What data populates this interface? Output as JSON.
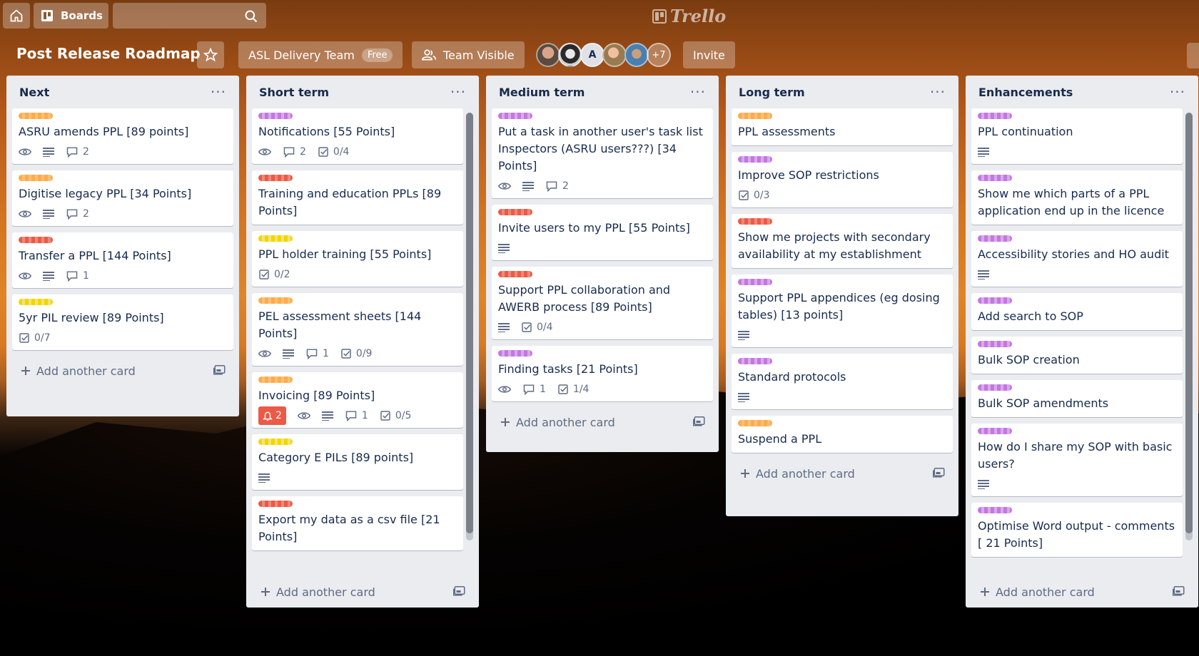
{
  "header": {
    "boards_label": "Boards",
    "search_placeholder": "",
    "logo_text": "Trello"
  },
  "board": {
    "title": "Post Release Roadmap",
    "team_name": "ASL Delivery Team",
    "team_plan": "Free",
    "visibility": "Team Visible",
    "members_extra": "+7",
    "member_initial": "A",
    "invite_label": "Invite"
  },
  "lists": [
    {
      "title": "Next",
      "add_label": "Add another card",
      "cards": [
        {
          "label": "orange",
          "title": "ASRU amends PPL [89 points]",
          "watch": true,
          "desc": true,
          "comments": "2"
        },
        {
          "label": "orange",
          "title": "Digitise legacy PPL [34 Points]",
          "watch": true,
          "desc": true,
          "comments": "2"
        },
        {
          "label": "red",
          "title": "Transfer a PPL [144 Points]",
          "watch": true,
          "desc": true,
          "comments": "1"
        },
        {
          "label": "yellow",
          "title": "5yr PIL review [89 Points]",
          "checklist": "0/7"
        }
      ]
    },
    {
      "title": "Short term",
      "add_label": "Add another card",
      "cards": [
        {
          "label": "purple",
          "title": "Notifications [55 Points]",
          "watch": true,
          "comments": "2",
          "checklist": "0/4"
        },
        {
          "label": "red",
          "title": "Training and education PPLs [89 Points]"
        },
        {
          "label": "yellow",
          "title": "PPL holder training [55 Points]",
          "checklist": "0/2"
        },
        {
          "label": "orange",
          "title": "PEL assessment sheets [144 Points]",
          "watch": true,
          "desc": true,
          "comments": "1",
          "checklist": "0/9"
        },
        {
          "label": "orange",
          "title": "Invoicing [89 Points]",
          "notifications": "2",
          "watch": true,
          "desc": true,
          "comments": "1",
          "checklist": "0/5"
        },
        {
          "label": "yellow",
          "title": "Category E PILs [89 points]",
          "desc": true
        },
        {
          "label": "red",
          "title": "Export my data as a csv file [21 Points]"
        }
      ]
    },
    {
      "title": "Medium term",
      "add_label": "Add another card",
      "cards": [
        {
          "label": "purple",
          "title": "Put a task in another user's task list Inspectors (ASRU users???) [34 Points]",
          "watch": true,
          "desc": true,
          "comments": "2"
        },
        {
          "label": "red",
          "title": "Invite users to my PPL [55 Points]",
          "desc": true
        },
        {
          "label": "red",
          "title": "Support PPL collaboration and AWERB process [89 Points]",
          "desc": true,
          "checklist": "0/4"
        },
        {
          "label": "purple",
          "title": "Finding tasks [21 Points]",
          "watch": true,
          "comments": "1",
          "checklist": "1/4"
        }
      ]
    },
    {
      "title": "Long term",
      "add_label": "Add another card",
      "cards": [
        {
          "label": "orange",
          "title": "PPL assessments"
        },
        {
          "label": "purple",
          "title": "Improve SOP restrictions",
          "checklist": "0/3"
        },
        {
          "label": "red",
          "title": "Show me projects with secondary availability at my establishment"
        },
        {
          "label": "purple",
          "title": "Support PPL appendices (eg dosing tables) [13 points]",
          "desc": true
        },
        {
          "label": "purple",
          "title": "Standard protocols",
          "desc": true
        },
        {
          "label": "orange",
          "title": "Suspend a PPL"
        }
      ]
    },
    {
      "title": "Enhancements",
      "add_label": "Add another card",
      "cards": [
        {
          "label": "purple",
          "title": "PPL continuation",
          "desc": true
        },
        {
          "label": "purple",
          "title": "Show me which parts of a PPL application end up in the licence"
        },
        {
          "label": "purple",
          "title": "Accessibility stories and HO audit",
          "desc": true
        },
        {
          "label": "purple",
          "title": "Add search to SOP"
        },
        {
          "label": "purple",
          "title": "Bulk SOP creation"
        },
        {
          "label": "purple",
          "title": "Bulk SOP amendments"
        },
        {
          "label": "purple",
          "title": "How do I share my SOP with basic users?",
          "desc": true
        },
        {
          "label": "purple",
          "title": "Optimise Word output - comments [ 21 Points]"
        }
      ]
    }
  ]
}
